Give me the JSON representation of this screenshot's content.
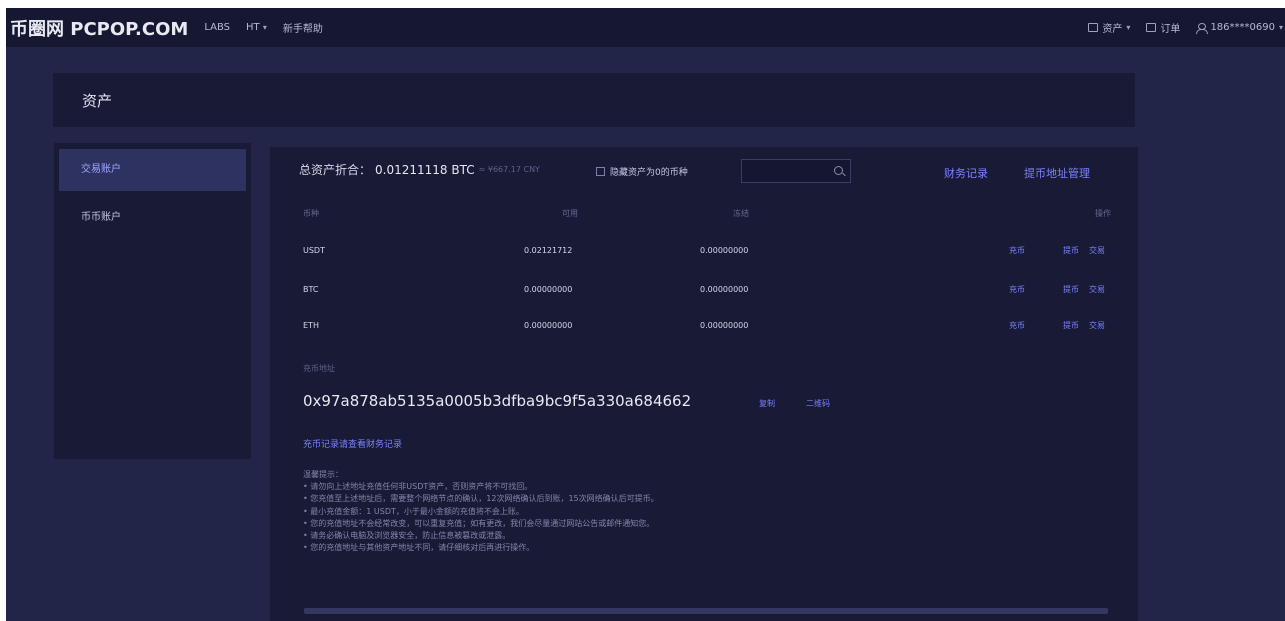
{
  "nav": {
    "logo": "币圈网 PCPOP.COM",
    "left_items": [
      "LABS",
      "HT",
      "新手帮助"
    ],
    "ht_dropdown_caret": "▾",
    "assets_label": "资产",
    "orders_label": "订单",
    "user_label": "186****0690"
  },
  "page": {
    "title": "资产"
  },
  "sidebar": {
    "items": [
      {
        "label": "交易账户",
        "active": true
      },
      {
        "label": "币币账户",
        "active": false
      }
    ]
  },
  "summary": {
    "label": "总资产折合：",
    "btc_value": "0.01211118 BTC",
    "cny_value": "≈ ¥667.17 CNY",
    "hide_small_label": "隐藏资产为0的币种",
    "search_placeholder": "",
    "finance_link": "财务记录",
    "address_manage_link": "提币地址管理"
  },
  "table": {
    "headers": {
      "coin": "币种",
      "available": "可用",
      "frozen": "冻结",
      "action": "操作"
    },
    "rows": [
      {
        "coin": "USDT",
        "available": "0.02121712",
        "frozen": "0.00000000",
        "actions": [
          "充币",
          "提币",
          "交易"
        ]
      },
      {
        "coin": "BTC",
        "available": "0.00000000",
        "frozen": "0.00000000",
        "actions": [
          "充币",
          "提币",
          "交易"
        ]
      },
      {
        "coin": "ETH",
        "available": "0.00000000",
        "frozen": "0.00000000",
        "actions": [
          "充币",
          "提币",
          "交易"
        ]
      }
    ]
  },
  "deposit": {
    "address_label": "充币地址",
    "address": "0x97a878ab5135a0005b3dfba9bc9f5a330a684662",
    "copy_label": "复制",
    "qrcode_label": "二维码",
    "records_link": "充币记录请查看财务记录",
    "tips": [
      "温馨提示：",
      "• 请勿向上述地址充值任何非USDT资产，否则资产将不可找回。",
      "• 您充值至上述地址后，需要整个网络节点的确认，12次网络确认后到账，15次网络确认后可提币。",
      "• 最小充值金额：1 USDT，小于最小金额的充值将不会上账。",
      "• 您的充值地址不会经常改变，可以重复充值；如有更改，我们会尽量通过网站公告或邮件通知您。",
      "• 请务必确认电脑及浏览器安全，防止信息被篡改或泄露。",
      "• 您的充值地址与其他资产地址不同，请仔细核对后再进行操作。"
    ]
  }
}
